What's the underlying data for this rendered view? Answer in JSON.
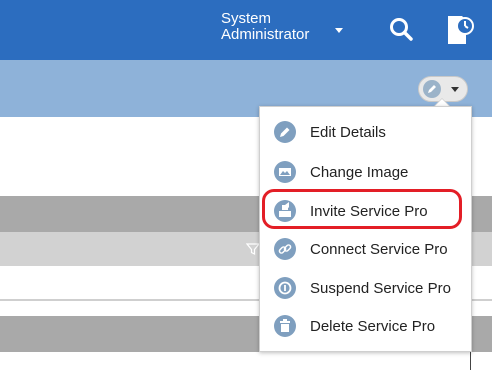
{
  "topbar": {
    "user_line1": "System",
    "user_line2": "Administrator"
  },
  "menu": {
    "items": [
      {
        "label": "Edit Details",
        "icon": "edit-icon"
      },
      {
        "label": "Change Image",
        "icon": "image-icon"
      },
      {
        "label": "Invite Service Pro",
        "icon": "invite-icon"
      },
      {
        "label": "Connect Service Pro",
        "icon": "link-icon"
      },
      {
        "label": "Suspend Service Pro",
        "icon": "suspend-icon"
      },
      {
        "label": "Delete Service Pro",
        "icon": "trash-icon"
      }
    ]
  },
  "colors": {
    "topbar": "#2c6dbf",
    "subbar": "#8eb2d9",
    "icon_bg": "#7f9fbf",
    "highlight": "#e31e26"
  }
}
